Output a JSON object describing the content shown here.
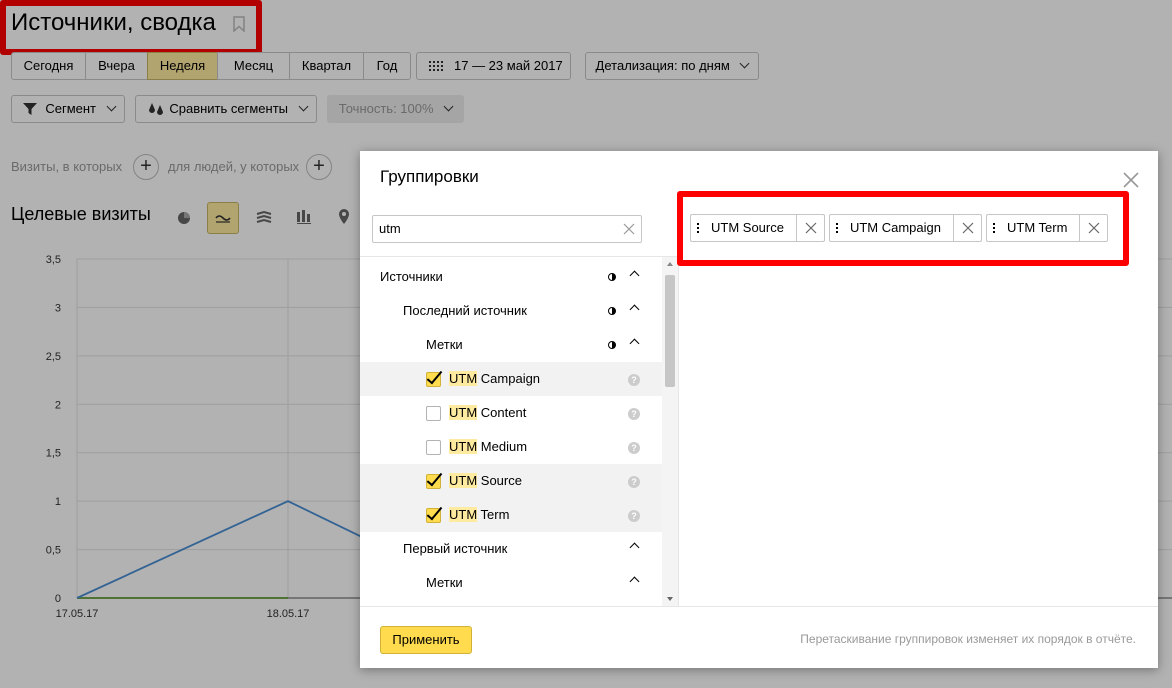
{
  "page": {
    "title": "Источники, сводка",
    "periods": [
      "Сегодня",
      "Вчера",
      "Неделя",
      "Месяц",
      "Квартал",
      "Год"
    ],
    "active_period": "Неделя",
    "date_range": "17 — 23 май 2017",
    "detail": "Детализация: по дням",
    "segment": "Сегмент",
    "compare": "Сравнить сегменты",
    "accuracy": "Точность: 100%",
    "filter_visits": "Визиты, в которых",
    "filter_people": "для людей, у которых",
    "section_title": "Целевые визиты",
    "chart_types": [
      "pie-icon",
      "line-icon",
      "area-icon",
      "bar-icon",
      "map-icon"
    ],
    "active_chart_type": "line-icon"
  },
  "chart_data": {
    "type": "line",
    "x": [
      "17.05.17",
      "18.05.17"
    ],
    "ylim": [
      0,
      3.5
    ],
    "yticks": [
      "3,5",
      "3",
      "2,5",
      "2",
      "1,5",
      "1",
      "0,5",
      "0"
    ],
    "grid": true,
    "series": [
      {
        "color": "#4a8fd4",
        "values": [
          0,
          1
        ]
      },
      {
        "color": "#6aad3c",
        "values": [
          0,
          0
        ]
      },
      {
        "color": "#8e44ad",
        "values": [
          0,
          0
        ]
      }
    ]
  },
  "modal": {
    "title": "Группировки",
    "search_value": "utm",
    "tree": [
      {
        "label": "Источники",
        "level": 0,
        "type": "group",
        "half": true
      },
      {
        "label": "Последний источник",
        "level": 1,
        "type": "group",
        "half": true
      },
      {
        "label": "Метки",
        "level": 2,
        "type": "group",
        "half": true
      },
      {
        "prefix": "UTM",
        "rest": " Campaign",
        "type": "item",
        "checked": true
      },
      {
        "prefix": "UTM",
        "rest": " Content",
        "type": "item",
        "checked": false
      },
      {
        "prefix": "UTM",
        "rest": " Medium",
        "type": "item",
        "checked": false
      },
      {
        "prefix": "UTM",
        "rest": " Source",
        "type": "item",
        "checked": true
      },
      {
        "prefix": "UTM",
        "rest": " Term",
        "type": "item",
        "checked": true
      },
      {
        "label": "Первый источник",
        "level": 1,
        "type": "group",
        "half": false
      },
      {
        "label": "Метки",
        "level": 2,
        "type": "group",
        "half": false
      }
    ],
    "chips": [
      "UTM Source",
      "UTM Campaign",
      "UTM Term"
    ],
    "apply": "Применить",
    "hint": "Перетаскивание группировок изменяет их порядок в отчёте."
  }
}
